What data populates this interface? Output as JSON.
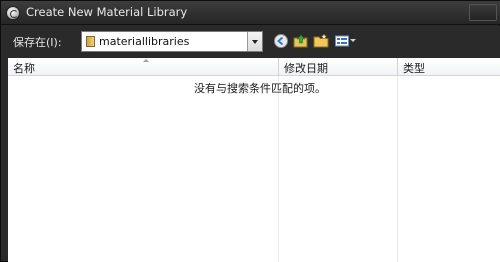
{
  "window": {
    "title": "Create New Material Library"
  },
  "toolbar": {
    "save_in_label": "保存在(I):",
    "path_value": "materiallibraries",
    "icons": [
      "back-icon",
      "up-folder-icon",
      "new-folder-icon",
      "view-menu-icon"
    ]
  },
  "list": {
    "columns": [
      {
        "label": "名称"
      },
      {
        "label": "修改日期"
      },
      {
        "label": "类型"
      }
    ],
    "empty_message": "没有与搜索条件匹配的项。"
  },
  "colors": {
    "window_bg": "#2a2a2a",
    "list_bg": "#ffffff",
    "folder": "#f2d27a"
  }
}
